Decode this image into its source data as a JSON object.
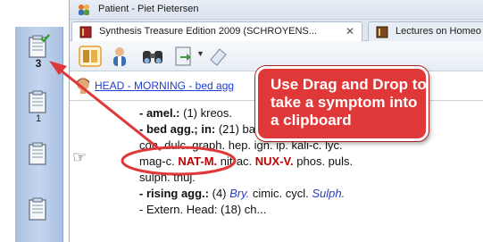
{
  "clipboards": [
    {
      "label": "3",
      "bold": true,
      "checked": true
    },
    {
      "label": "1",
      "bold": false,
      "checked": false
    },
    {
      "label": "",
      "bold": false,
      "checked": false
    },
    {
      "label": "",
      "bold": false,
      "checked": false
    }
  ],
  "window": {
    "title": "Patient - Piet Pietersen"
  },
  "tabs": [
    {
      "label": "Synthesis Treasure Edition 2009 (SCHROYENS...",
      "active": true
    },
    {
      "label": "Lectures on Homeo",
      "active": false
    }
  ],
  "toolbar": {
    "icons": [
      "book-icon",
      "doctor-icon",
      "binoculars-icon",
      "document-arrow-icon",
      "dropdown-arrow-icon",
      "eraser-icon"
    ]
  },
  "breadcrumb": {
    "text": "HEAD - MORNING - bed agg"
  },
  "rubrics": {
    "amel_label": "- amel.:",
    "amel_rest": " (1) kreos.",
    "bed_label": "- bed agg.; in:",
    "bed_rest": " (21) ba",
    "line3": "con. dulc. graph. hep. ign. ip. kali-c. lyc.",
    "line4_a": "mag-c. ",
    "line4_nat": "NAT-M.",
    "line4_b": " nit-ac. ",
    "line4_nux": "NUX-V.",
    "line4_c": " phos. puls.",
    "line5": "sulph. thuj.",
    "rising_label": "- rising agg.:",
    "rising_a": " (4) ",
    "rising_bry": "Bry.",
    "rising_b": " cimic. cycl. ",
    "rising_sulph": "Sulph.",
    "last_line": "- Extern. Head: (18) ch..."
  },
  "callout": {
    "text": "Use Drag and Drop to take a symptom into a clipboard"
  },
  "colors": {
    "annotation_red": "#e03838",
    "link_blue": "#1f3fd1",
    "remedy_red": "#c00000",
    "remedy_blue": "#2a3fc2"
  }
}
